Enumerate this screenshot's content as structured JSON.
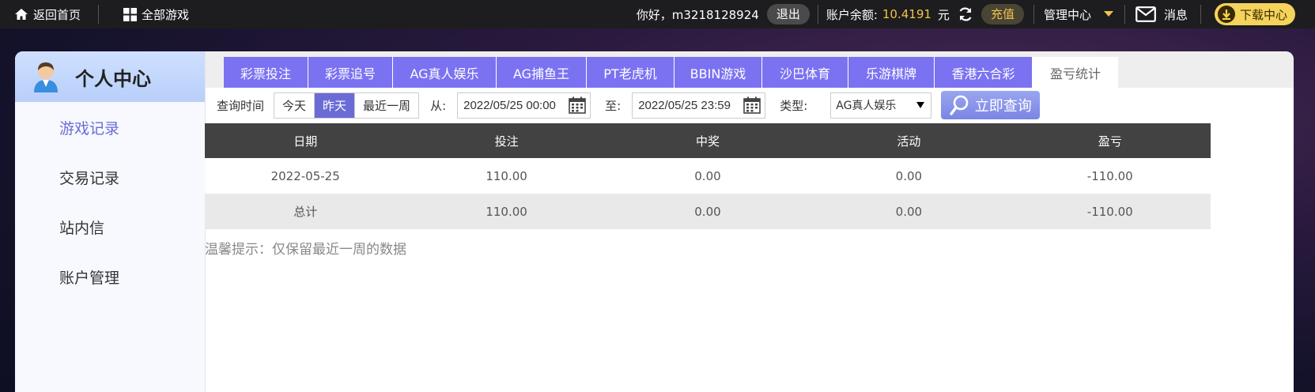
{
  "topbar": {
    "home_label": "返回首页",
    "all_games_label": "全部游戏",
    "greeting": "你好，m3218128924",
    "logout_label": "退出",
    "balance_label": "账户余额:",
    "balance_value": "10.4191",
    "balance_unit": "元",
    "recharge_label": "充值",
    "manage_label": "管理中心",
    "messages_label": "消息",
    "download_label": "下载中心"
  },
  "sidebar": {
    "title": "个人中心",
    "items": [
      {
        "label": "游戏记录"
      },
      {
        "label": "交易记录"
      },
      {
        "label": "站内信"
      },
      {
        "label": "账户管理"
      }
    ]
  },
  "tabs": [
    {
      "label": "彩票投注"
    },
    {
      "label": "彩票追号"
    },
    {
      "label": "AG真人娱乐"
    },
    {
      "label": "AG捕鱼王"
    },
    {
      "label": "PT老虎机"
    },
    {
      "label": "BBIN游戏"
    },
    {
      "label": "沙巴体育"
    },
    {
      "label": "乐游棋牌"
    },
    {
      "label": "香港六合彩"
    },
    {
      "label": "盈亏统计"
    }
  ],
  "filter": {
    "time_label": "查询时间",
    "ranges": [
      "今天",
      "昨天",
      "最近一周"
    ],
    "from_label": "从:",
    "from_value": "2022/05/25 00:00",
    "to_label": "至:",
    "to_value": "2022/05/25 23:59",
    "type_label": "类型:",
    "type_value": "AG真人娱乐",
    "query_label": "立即查询"
  },
  "table": {
    "columns": [
      "日期",
      "投注",
      "中奖",
      "活动",
      "盈亏"
    ],
    "rows": [
      [
        "2022-05-25",
        "110.00",
        "0.00",
        "0.00",
        "-110.00"
      ],
      [
        "总计",
        "110.00",
        "0.00",
        "0.00",
        "-110.00"
      ]
    ]
  },
  "hint": "温馨提示：仅保留最近一周的数据",
  "colors": {
    "accent": "#7b72f2",
    "gold": "#f0c34a",
    "topbar": "#1d1d1f"
  }
}
